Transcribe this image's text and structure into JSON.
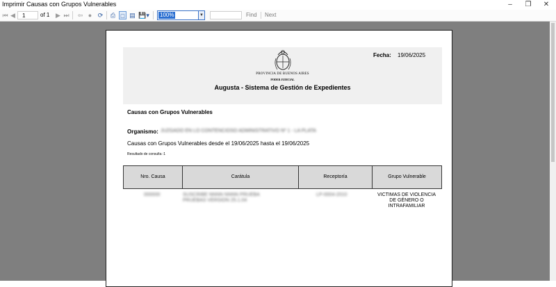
{
  "window": {
    "title": "Imprimir Causas con Grupos Vulnerables",
    "minimize_icon": "minimize-icon",
    "maximize_icon": "maximize-icon",
    "close_icon": "close-icon"
  },
  "toolbar": {
    "page_current": "1",
    "page_of_label": "of",
    "page_total": "1",
    "zoom": "100%",
    "find_placeholder": "",
    "find_label": "Find",
    "next_label": "Next",
    "icons": [
      "first-page-icon",
      "previous-page-icon",
      "next-page-icon",
      "last-page-icon",
      "back-icon",
      "stop-icon",
      "refresh-icon",
      "print-icon",
      "print-layout-icon",
      "page-setup-icon",
      "export-icon"
    ]
  },
  "report": {
    "fecha_label": "Fecha:",
    "fecha_value": "19/06/2025",
    "province": "PROVINCIA DE BUENOS AIRES",
    "poder": "PODER JUDICIAL",
    "system_title": "Augusta - Sistema de Gestión de Expedientes",
    "report_title": "Causas con Grupos Vulnerables",
    "organismo_label": "Organismo:",
    "organismo_value": "JUZGADO EN LO CONTENCIOSO ADMINISTRATIVO Nº 1 - LA PLATA",
    "range_text": "Causas con Grupos Vulnerables desde el 19/06/2025 hasta el 19/06/2025",
    "result_text": "Resultado de consulta :1"
  },
  "table": {
    "headers": [
      "Nro. Causa",
      "Carátula",
      "Receptoría",
      "Grupo Vulnerable"
    ],
    "rows": [
      {
        "nro": "000000",
        "caratula_1": "SUSCRIBE NNNN NNNN PRUEBA",
        "caratula_2": "PRUEBAS VERSION 25.1.04",
        "receptoria": "LP-0004-2010",
        "grupo_1": "VICTIMAS DE VIOLENCIA",
        "grupo_2": "DE GÉNERO O",
        "grupo_3": "INTRAFAMILIAR"
      }
    ]
  }
}
